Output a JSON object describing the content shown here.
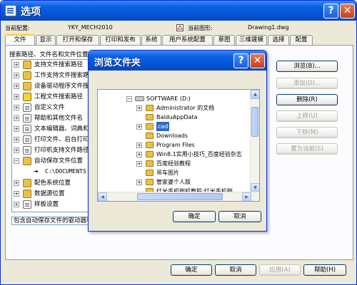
{
  "window": {
    "title": "选项",
    "help_glyph": "?",
    "close_glyph": "✕"
  },
  "top": {
    "profile_label": "当前配置:",
    "profile_value": "YKY_MECH2010",
    "drawing_label": "当前图形:",
    "drawing_value": "Drawing1.dwg"
  },
  "tabs": [
    "文件",
    "显示",
    "打开和保存",
    "打印和发布",
    "系统",
    "用户系统配置",
    "草图",
    "三维建模",
    "选择",
    "配置"
  ],
  "search_label": "搜索路径、文件名和文件位置:",
  "tree": [
    {
      "label": "支持文件搜索路径"
    },
    {
      "label": "工作支持文件搜索路径"
    },
    {
      "label": "设备驱动程序文件搜索路径"
    },
    {
      "label": "工程文件搜索路径"
    },
    {
      "label": "自定义文件"
    },
    {
      "label": "帮助和其他文件名"
    },
    {
      "label": "文本编辑器、词典和字体文件名"
    },
    {
      "label": "打印文件、后台打印程序和前导部分名称"
    },
    {
      "label": "打印机支持文件路径"
    },
    {
      "label": "自动保存文件位置"
    },
    {
      "label": "C:\\DOCUMENTS"
    },
    {
      "label": "配色系统位置"
    },
    {
      "label": "数据源位置"
    },
    {
      "label": "样板设置"
    }
  ],
  "description": "包含自动保存文件的驱动器和文件夹",
  "side_buttons": {
    "browse": "浏览(B)...",
    "add": "添加(D)...",
    "delete": "删除(R)",
    "up": "上移(U)",
    "down": "下移(M)",
    "set_current": "置为当前(S)"
  },
  "bottom_buttons": {
    "ok": "确定",
    "cancel": "取消",
    "apply": "应用(A)",
    "help": "帮助(H)"
  },
  "browse_dialog": {
    "title": "浏览文件夹",
    "help_glyph": "?",
    "close_glyph": "✕",
    "root": "SOFTWARE (D:)",
    "folders": [
      {
        "label": "Administrator 的文档"
      },
      {
        "label": "BaiduAppData"
      },
      {
        "label": "cad"
      },
      {
        "label": "Downloads"
      },
      {
        "label": "Program Files"
      },
      {
        "label": "Win8.1实用小技巧_百度经验杂志"
      },
      {
        "label": "百度经验教程"
      },
      {
        "label": "吊车图片"
      },
      {
        "label": "管家婆个人版"
      },
      {
        "label": "红米手机刷机教程:红米手机刷"
      }
    ],
    "ok": "确定",
    "cancel": "取消"
  }
}
